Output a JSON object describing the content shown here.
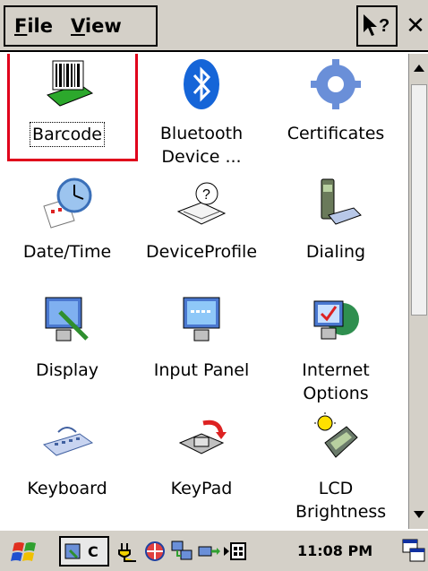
{
  "menu": {
    "file_label": "File",
    "view_label": "View"
  },
  "items": [
    {
      "label": "Barcode"
    },
    {
      "label": "Bluetooth Device ..."
    },
    {
      "label": "Certificates"
    },
    {
      "label": "Date/Time"
    },
    {
      "label": "DeviceProfile"
    },
    {
      "label": "Dialing"
    },
    {
      "label": "Display"
    },
    {
      "label": "Input Panel"
    },
    {
      "label": "Internet Options"
    },
    {
      "label": "Keyboard"
    },
    {
      "label": "KeyPad"
    },
    {
      "label": "LCD Brightness"
    }
  ],
  "taskbar": {
    "task_label": "C",
    "clock": "11:08 PM"
  }
}
